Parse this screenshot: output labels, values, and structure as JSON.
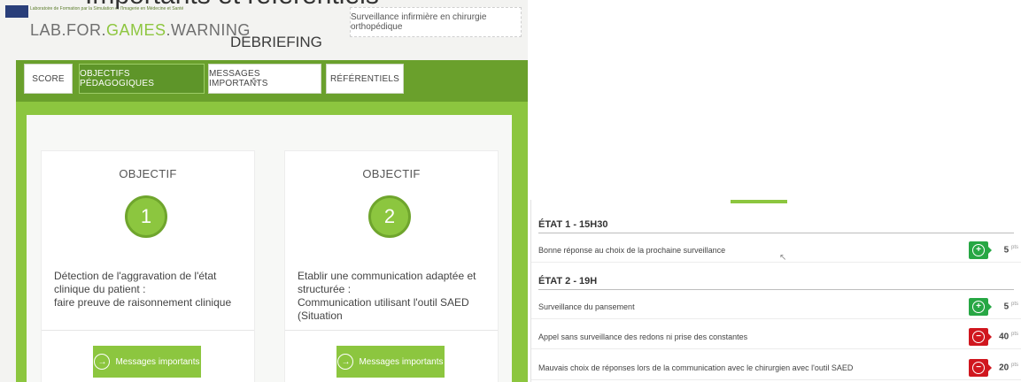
{
  "caption": "Importants et référentiels",
  "header": {
    "logo_small_text": "Laboratoire de Formation par la Simulation et l'Imagerie en Médecine et Santé",
    "brand_part1": "LAB.FOR.",
    "brand_part2": "GAMES",
    "brand_part3": ".WARNING",
    "page_title": "DEBRIEFING",
    "scenario": "Surveillance infirmière en chirurgie orthopédique"
  },
  "tabs": [
    {
      "label": "SCORE",
      "active": false
    },
    {
      "label": "OBJECTIFS PÉDAGOGIQUES",
      "active": true
    },
    {
      "label": "MESSAGES IMPORTANTS",
      "active": false
    },
    {
      "label": "RÉFÉRENTIELS",
      "active": false
    }
  ],
  "objectives": [
    {
      "heading": "OBJECTIF",
      "number": "1",
      "text": "Détection de l'aggravation de l'état clinique du patient :\nfaire preuve de raisonnement clinique",
      "button": "Messages importants"
    },
    {
      "heading": "OBJECTIF",
      "number": "2",
      "text": "Etablir une communication adaptée et structurée :\nCommunication utilisant l'outil SAED (Situation",
      "button": "Messages importants"
    }
  ],
  "score_panel": {
    "states": [
      {
        "title": "ÉTAT 1 - 15H30",
        "rows": [
          {
            "label": "Bonne réponse au choix de la prochaine surveillance",
            "sign": "+",
            "points": "5",
            "unit": "pts",
            "color": "#27a744"
          }
        ]
      },
      {
        "title": "ÉTAT 2 - 19H",
        "rows": [
          {
            "label": "Surveillance du pansement",
            "sign": "+",
            "points": "5",
            "unit": "pts",
            "color": "#27a744"
          },
          {
            "label": "Appel sans surveillance des redons ni prise des constantes",
            "sign": "−",
            "points": "40",
            "unit": "pts",
            "color": "#d0161e"
          },
          {
            "label": "Mauvais choix de réponses lors de la communication avec le chirurgien avec l'outil SAED",
            "sign": "−",
            "points": "20",
            "unit": "pts",
            "color": "#d0161e"
          }
        ]
      }
    ]
  },
  "colors": {
    "accent_green": "#8cc63f",
    "dark_green": "#6aa02c",
    "positive": "#27a744",
    "negative": "#d0161e"
  }
}
